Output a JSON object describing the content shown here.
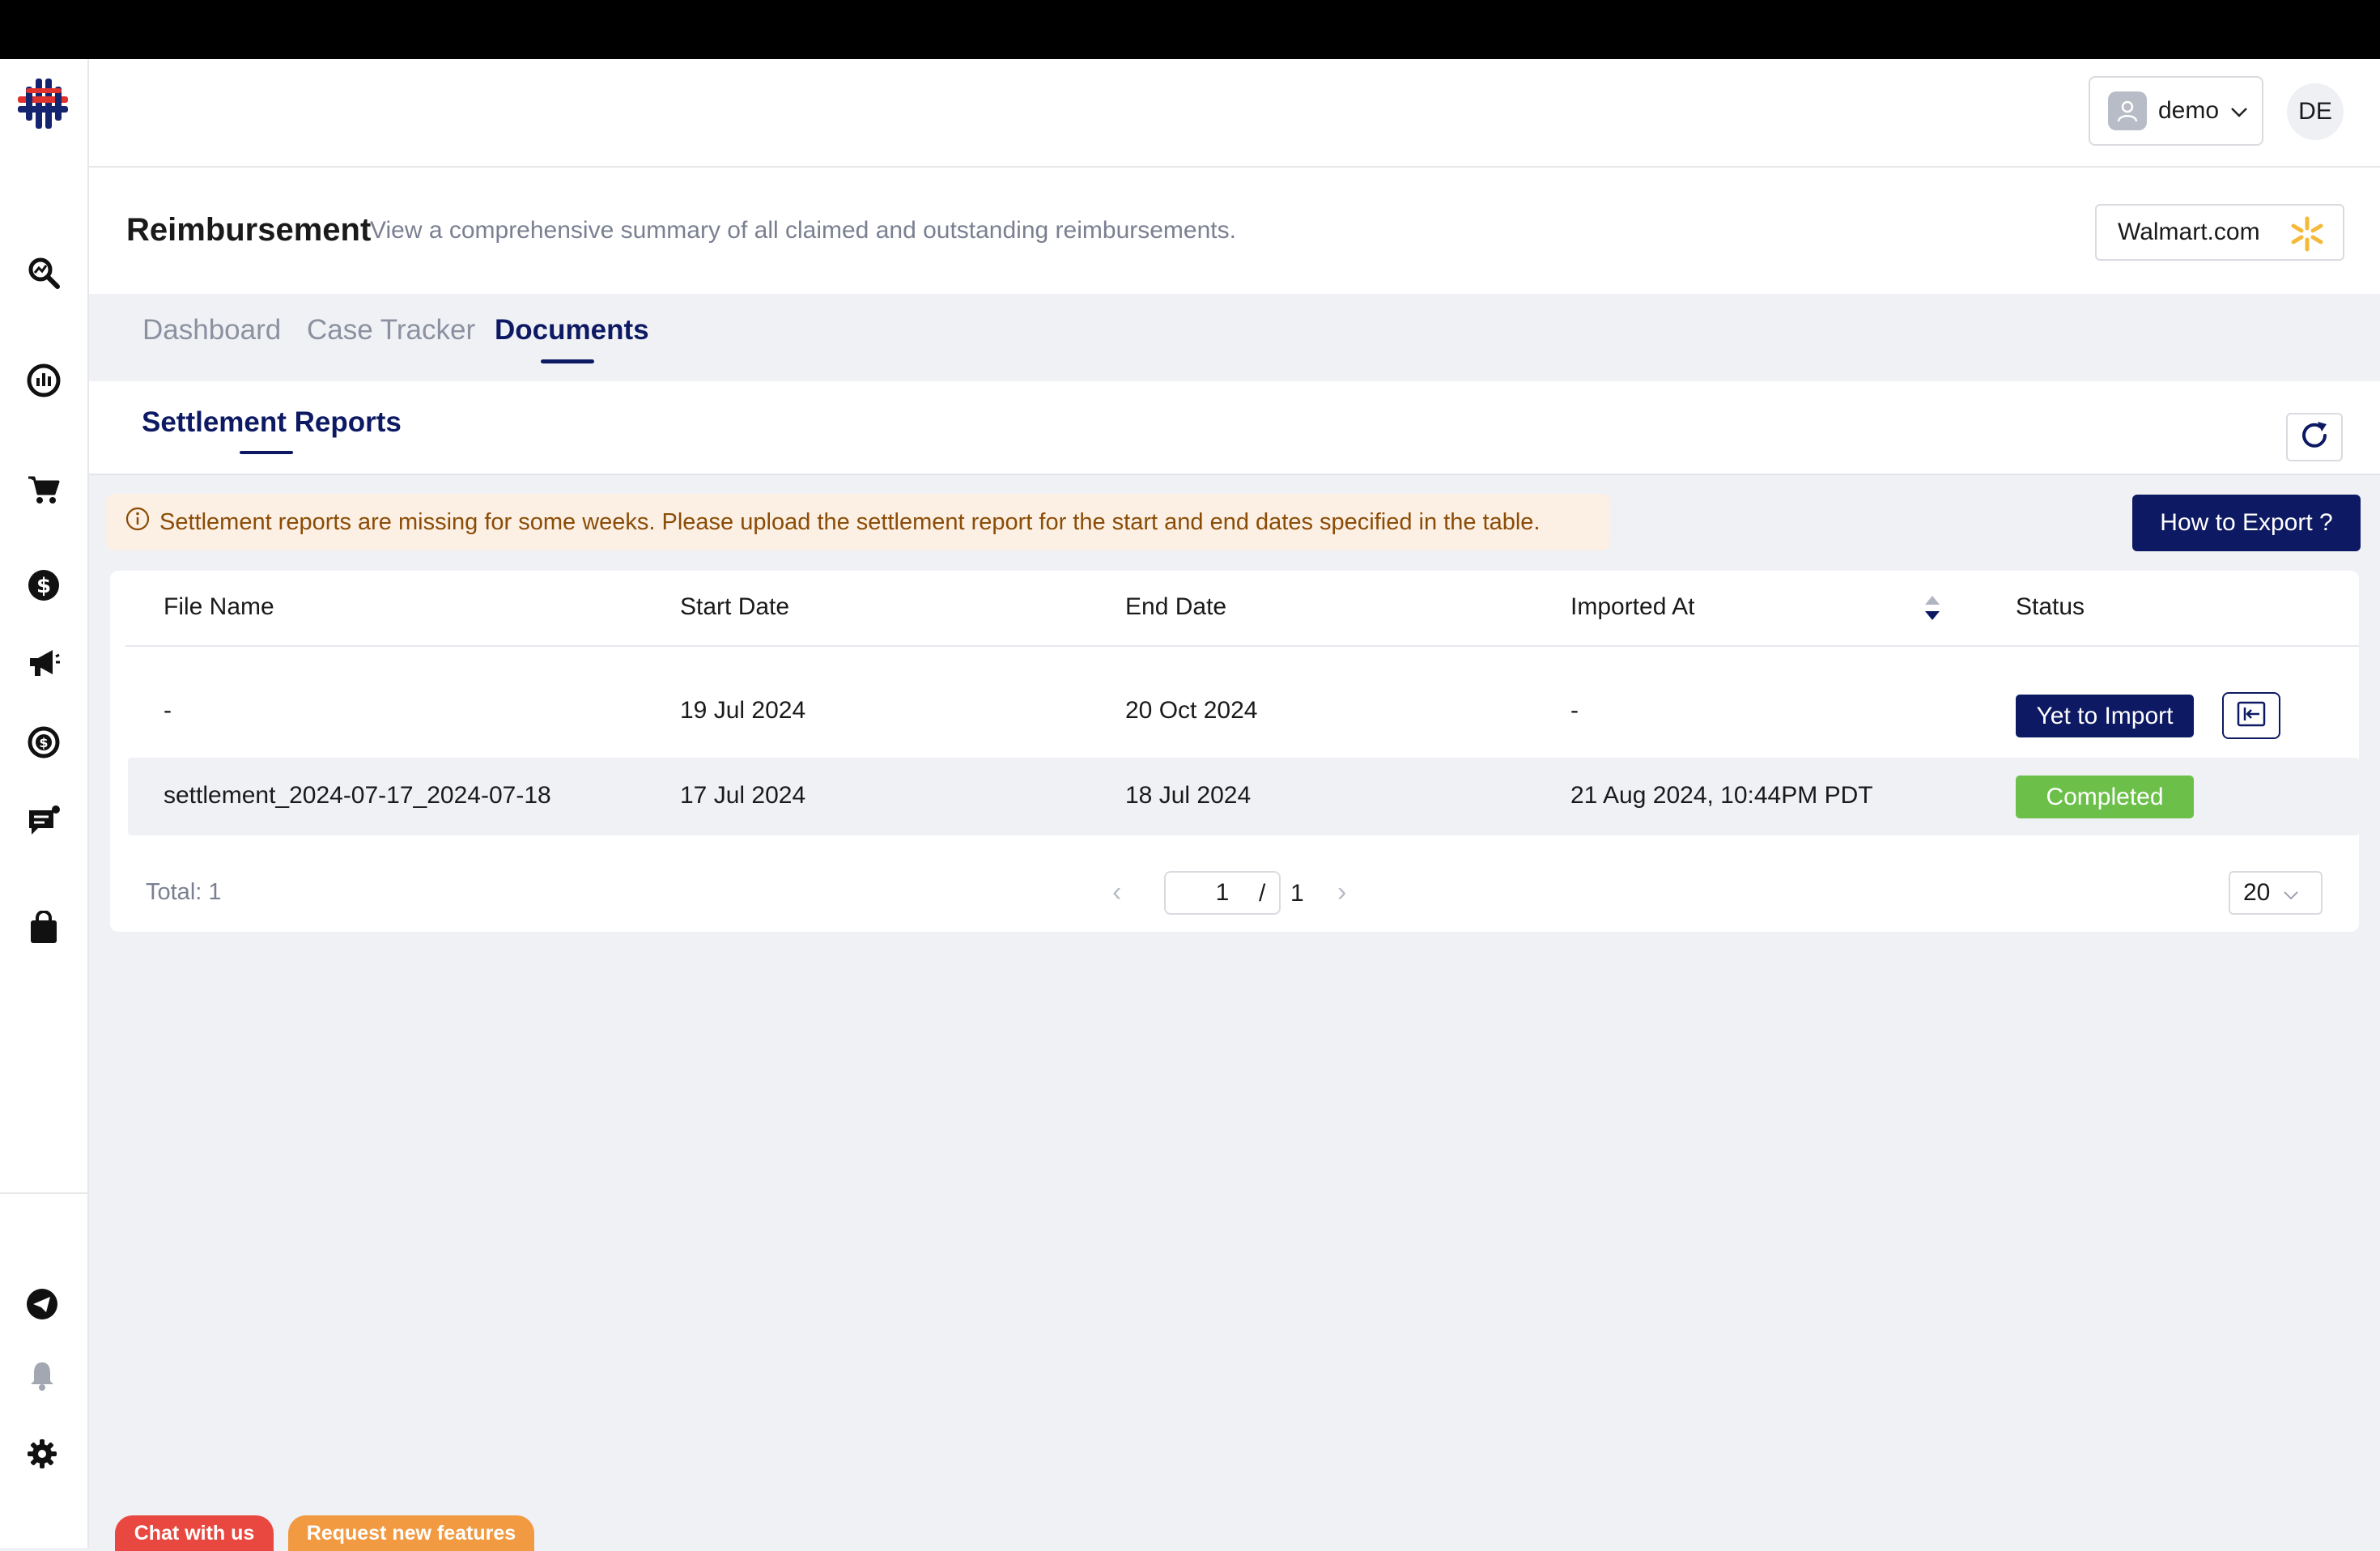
{
  "header": {
    "user_label": "demo",
    "initials": "DE"
  },
  "page": {
    "title": "Reimbursement",
    "subtitle": "View a comprehensive summary of all claimed and outstanding reimbursements.",
    "marketplace": "Walmart.com"
  },
  "tabs": [
    {
      "label": "Dashboard",
      "active": false
    },
    {
      "label": "Case Tracker",
      "active": false
    },
    {
      "label": "Documents",
      "active": true
    }
  ],
  "documents": {
    "subtab": "Settlement Reports",
    "alert": "Settlement reports are missing for some weeks. Please upload the settlement report for the start and end dates specified in the table.",
    "export_button": "How to Export ?",
    "columns": [
      "File Name",
      "Start Date",
      "End Date",
      "Imported At",
      "Status"
    ],
    "rows": [
      {
        "file_name": "-",
        "start_date": "19 Jul 2024",
        "end_date": "20 Oct 2024",
        "imported_at": "-",
        "status": "Yet to Import"
      },
      {
        "file_name": "settlement_2024-07-17_2024-07-18",
        "start_date": "17 Jul 2024",
        "end_date": "18 Jul 2024",
        "imported_at": "21 Aug 2024, 10:44PM PDT",
        "status": "Completed"
      }
    ],
    "pagination": {
      "total": "Total: 1",
      "current_page": "1",
      "separator": "/",
      "total_pages": "1",
      "page_size": "20"
    }
  },
  "footer": {
    "chat": "Chat with us",
    "request": "Request new features"
  },
  "sidebar": {
    "icons": [
      "logo-icon",
      "search-analytics-icon",
      "dashboard-gauge-icon",
      "cart-icon",
      "dollar-icon",
      "megaphone-icon",
      "refund-cycle-icon",
      "chat-bubble-icon",
      "shopping-bag-icon",
      "telegram-icon",
      "bell-icon",
      "settings-gear-icon"
    ]
  },
  "colors": {
    "primary": "#0d1a63",
    "success": "#6cc04a",
    "alert_bg": "#fcefe3",
    "alert_text": "#8b4c06",
    "chat": "#e8483f",
    "request": "#f19a42",
    "walmart_spark": "#f4b93a"
  }
}
